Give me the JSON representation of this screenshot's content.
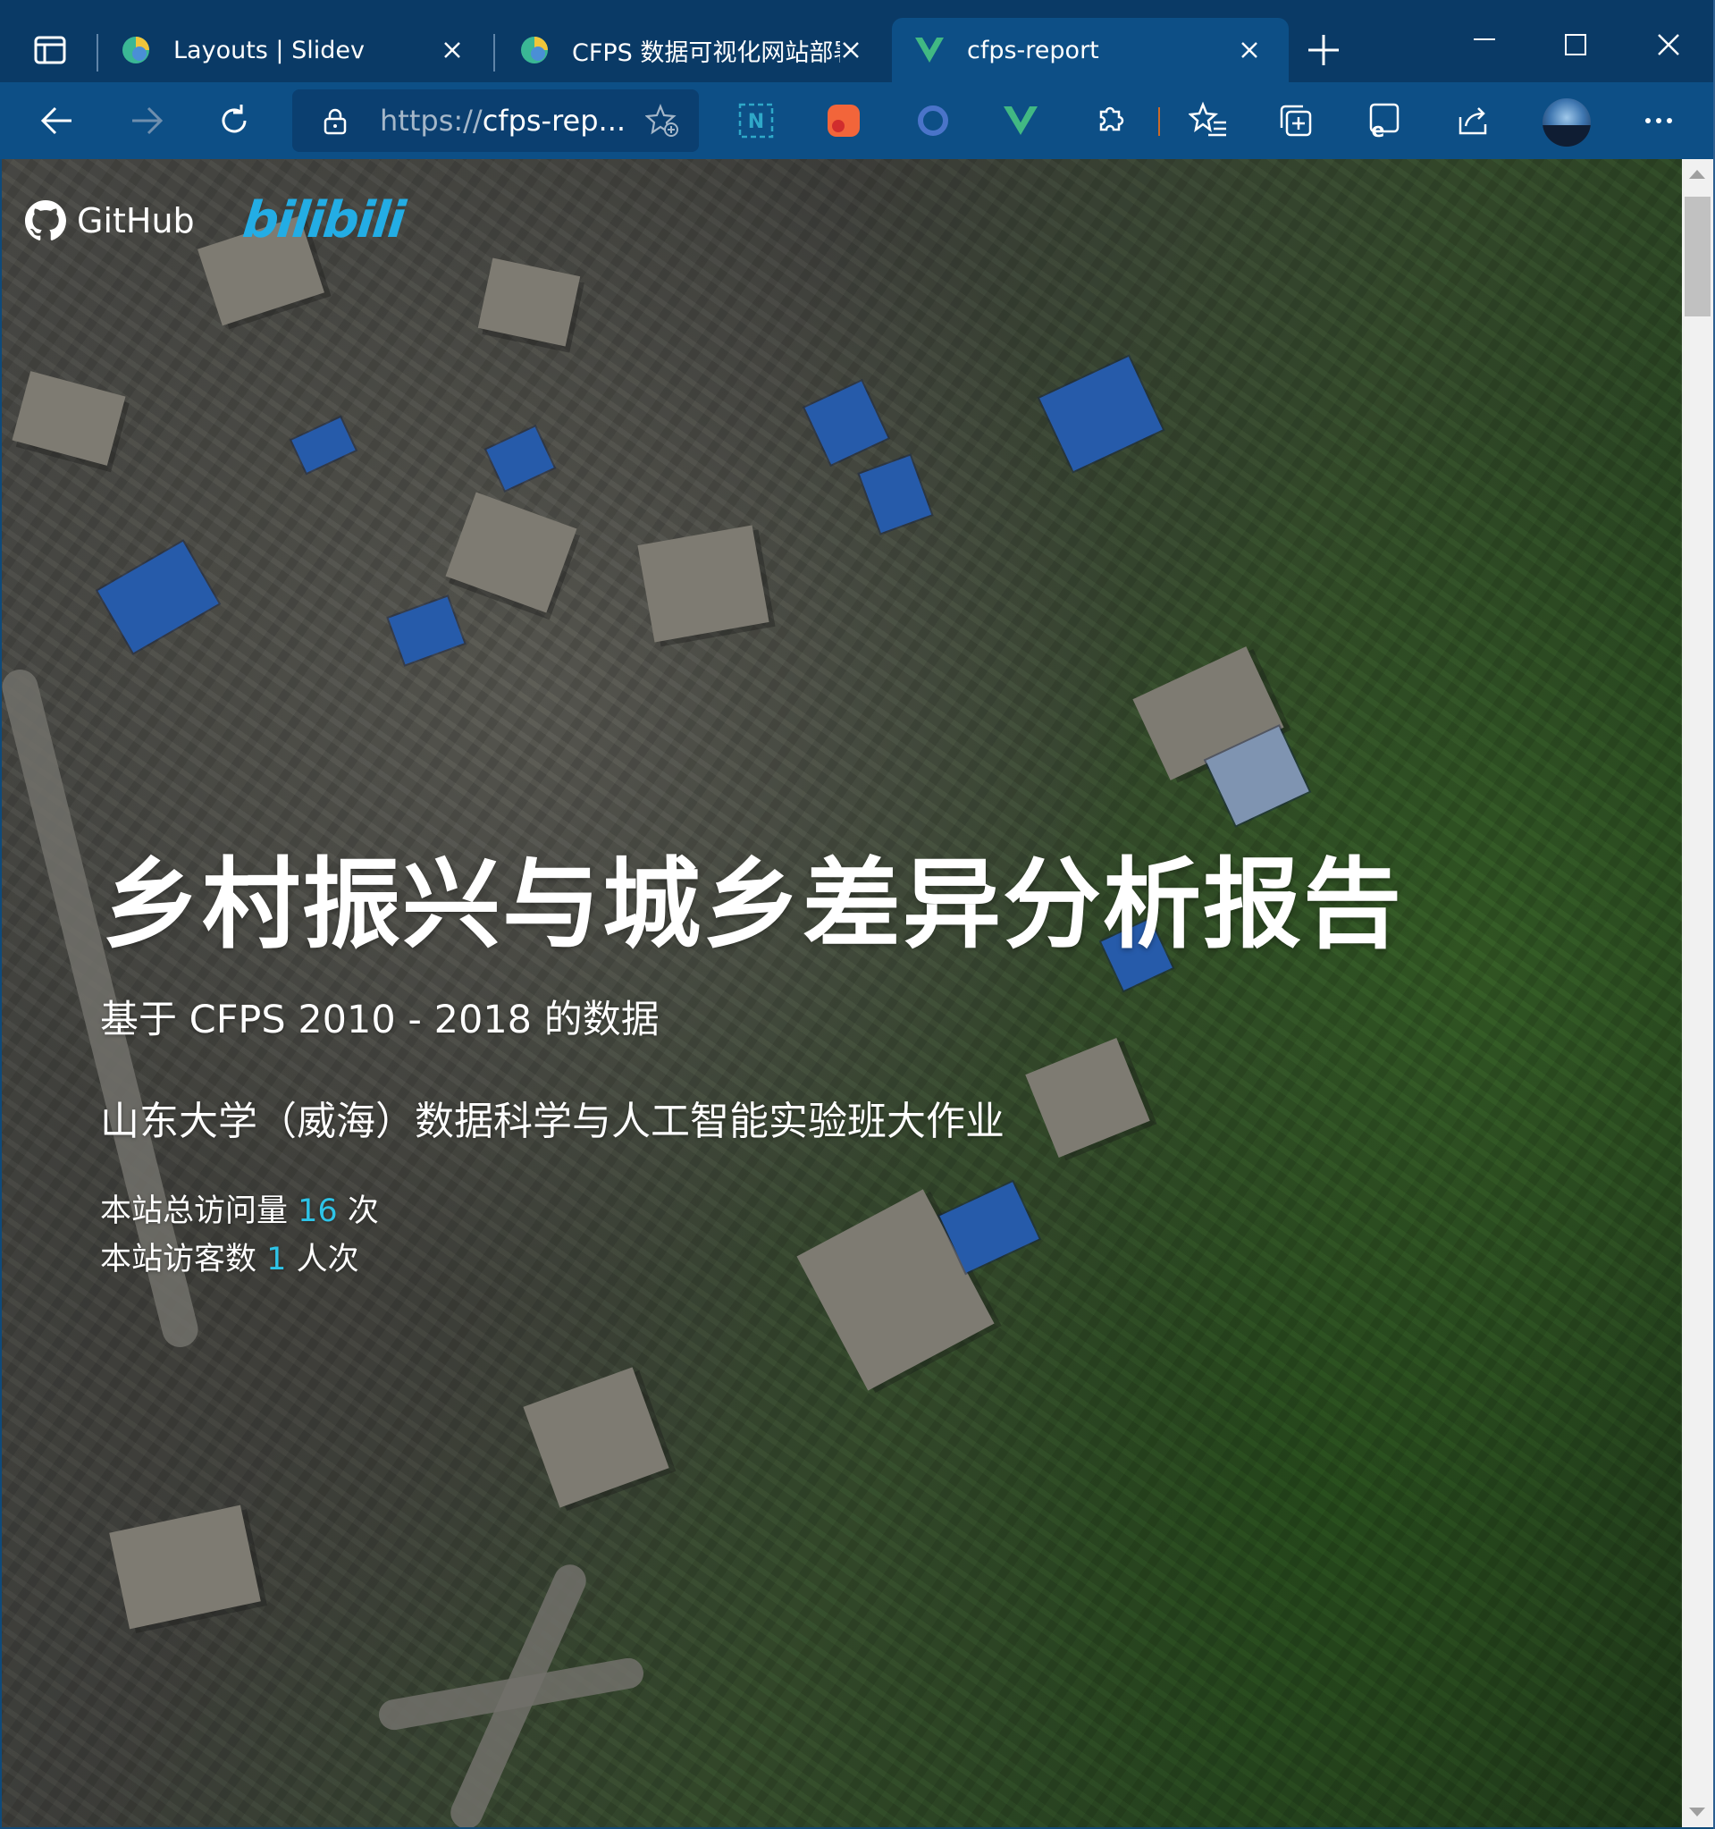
{
  "tabs": [
    {
      "title": "Layouts | Slidev",
      "active": false,
      "favicon": "slidev-icon"
    },
    {
      "title": "CFPS 数据可视化网站部署",
      "active": false,
      "favicon": "slidev-icon"
    },
    {
      "title": "cfps-report",
      "active": true,
      "favicon": "vue-icon"
    }
  ],
  "address": {
    "protocol": "https://",
    "host": "cfps-rep..."
  },
  "page": {
    "github_label": "GitHub",
    "bilibili_label": "bilibili",
    "title": "乡村振兴与城乡差异分析报告",
    "subtitle": "基于 CFPS 2010 - 2018 的数据",
    "course": "山东大学（威海）数据科学与人工智能实验班大作业",
    "stats": {
      "total_prefix": "本站总访问量",
      "total_value": "16",
      "total_suffix": "次",
      "visitor_prefix": "本站访客数",
      "visitor_value": "1",
      "visitor_suffix": "人次"
    }
  },
  "colors": {
    "browser_chrome": "#0d4f86",
    "tabstrip": "#0a3a66",
    "accent_number": "#2ec4e8",
    "bilibili": "#23ade5"
  }
}
